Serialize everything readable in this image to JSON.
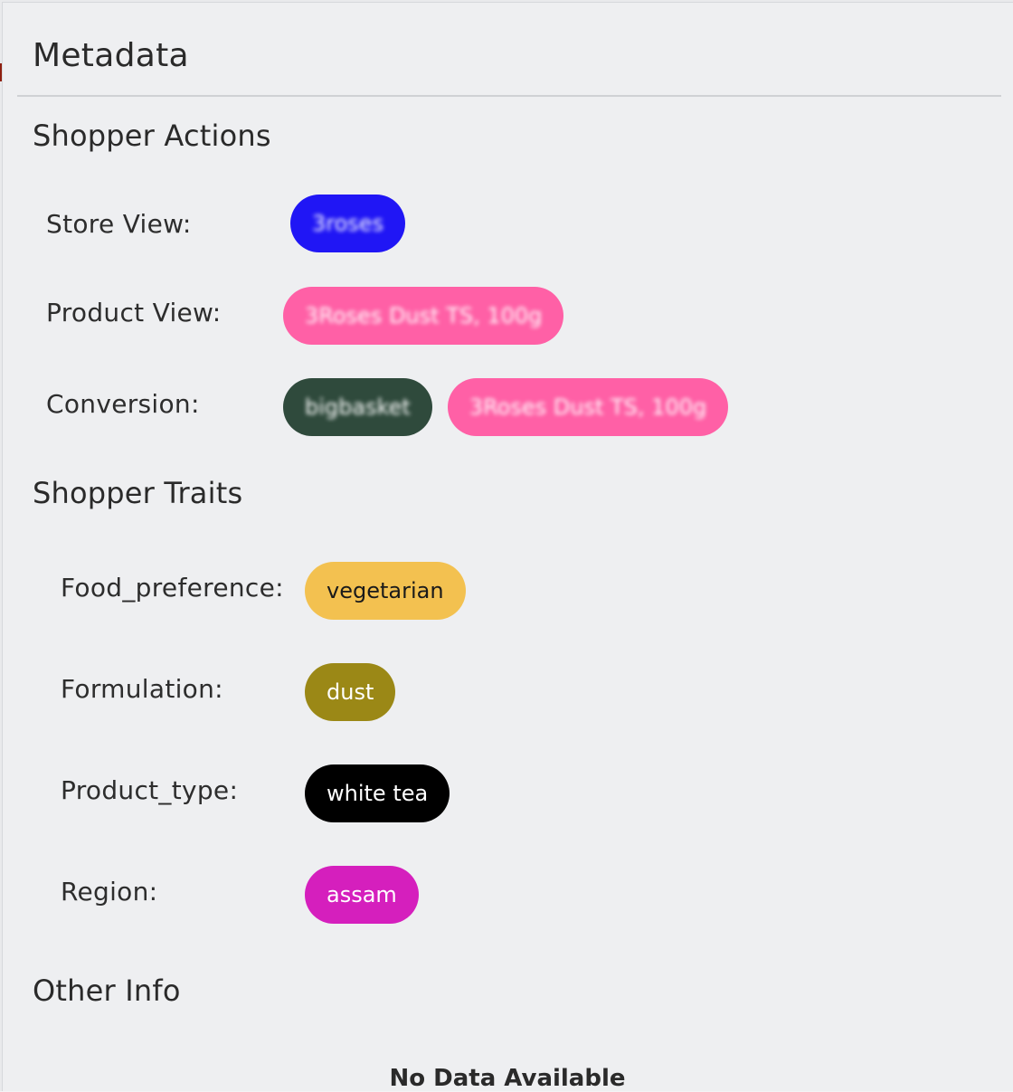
{
  "panel": {
    "title": "Metadata"
  },
  "shopper_actions": {
    "title": "Shopper Actions",
    "rows": [
      {
        "label": "Store View:",
        "chips": [
          {
            "text": "3roses",
            "bg": "#2016f5",
            "color": "#ffffff",
            "blurred": true
          }
        ]
      },
      {
        "label": "Product View:",
        "chips": [
          {
            "text": "3Roses Dust TS, 100g",
            "bg": "#ff60a6",
            "color": "#ffffff",
            "blurred": true
          }
        ]
      },
      {
        "label": "Conversion:",
        "chips": [
          {
            "text": "bigbasket",
            "bg": "#2f4a3c",
            "color": "#ffffff",
            "blurred": true
          },
          {
            "text": "3Roses Dust TS, 100g",
            "bg": "#ff60a6",
            "color": "#ffffff",
            "blurred": true
          }
        ]
      }
    ]
  },
  "shopper_traits": {
    "title": "Shopper Traits",
    "rows": [
      {
        "label": "Food_preference:",
        "chip": {
          "text": "vegetarian",
          "bg": "#f3c150",
          "color": "#1a1a1a"
        }
      },
      {
        "label": "Formulation:",
        "chip": {
          "text": "dust",
          "bg": "#9b8816",
          "color": "#ffffff"
        }
      },
      {
        "label": "Product_type:",
        "chip": {
          "text": "white tea",
          "bg": "#000000",
          "color": "#ffffff"
        }
      },
      {
        "label": "Region:",
        "chip": {
          "text": "assam",
          "bg": "#d51fbd",
          "color": "#ffffff"
        }
      }
    ]
  },
  "other_info": {
    "title": "Other Info",
    "empty_text": "No Data Available"
  }
}
